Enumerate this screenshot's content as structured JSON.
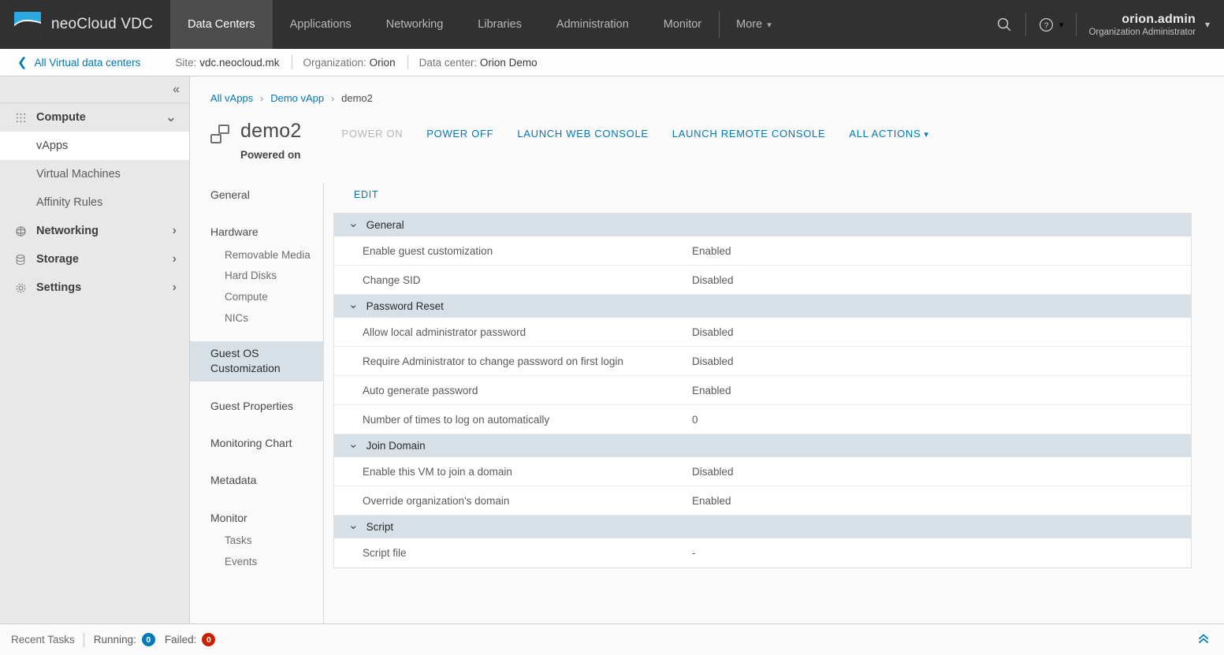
{
  "header": {
    "brand": "neoCloud VDC",
    "logo_color": "#2aa8e0",
    "nav": [
      {
        "label": "Data Centers",
        "active": true
      },
      {
        "label": "Applications",
        "active": false
      },
      {
        "label": "Networking",
        "active": false
      },
      {
        "label": "Libraries",
        "active": false
      },
      {
        "label": "Administration",
        "active": false
      },
      {
        "label": "Monitor",
        "active": false
      },
      {
        "label": "More",
        "active": false,
        "caret": true
      }
    ],
    "search_icon": "search-icon",
    "help_icon": "help-icon",
    "user_name": "orion.admin",
    "user_role": "Organization Administrator"
  },
  "context_bar": {
    "back_label": "All Virtual data centers",
    "site_label": "Site:",
    "site_value": "vdc.neocloud.mk",
    "org_label": "Organization:",
    "org_value": "Orion",
    "dc_label": "Data center:",
    "dc_value": "Orion Demo"
  },
  "sidebar": {
    "collapse_label": "«",
    "groups": [
      {
        "label": "Compute",
        "icon": "grid-icon",
        "expanded": true,
        "items": [
          {
            "label": "vApps",
            "active": true
          },
          {
            "label": "Virtual Machines",
            "active": false
          },
          {
            "label": "Affinity Rules",
            "active": false
          }
        ]
      },
      {
        "label": "Networking",
        "icon": "network-icon",
        "expanded": false,
        "items": []
      },
      {
        "label": "Storage",
        "icon": "storage-icon",
        "expanded": false,
        "items": []
      },
      {
        "label": "Settings",
        "icon": "gear-icon",
        "expanded": false,
        "items": []
      }
    ]
  },
  "breadcrumb": [
    {
      "label": "All vApps",
      "link": true
    },
    {
      "label": "Demo vApp",
      "link": true
    },
    {
      "label": "demo2",
      "link": false
    }
  ],
  "vm": {
    "name": "demo2",
    "state": "Powered on",
    "icon": "virtual-machine-icon",
    "actions": [
      {
        "label": "POWER ON",
        "disabled": true
      },
      {
        "label": "POWER OFF",
        "disabled": false
      },
      {
        "label": "LAUNCH WEB CONSOLE",
        "disabled": false
      },
      {
        "label": "LAUNCH REMOTE CONSOLE",
        "disabled": false
      },
      {
        "label": "ALL ACTIONS",
        "disabled": false,
        "caret": true
      }
    ]
  },
  "inner_nav": [
    {
      "label": "General",
      "type": "top",
      "selected": false
    },
    {
      "label": "Hardware",
      "type": "top",
      "selected": false,
      "gap": true
    },
    {
      "label": "Removable Media",
      "type": "sub",
      "selected": false
    },
    {
      "label": "Hard Disks",
      "type": "sub",
      "selected": false
    },
    {
      "label": "Compute",
      "type": "sub",
      "selected": false
    },
    {
      "label": "NICs",
      "type": "sub",
      "selected": false
    },
    {
      "label": "Guest OS Customization",
      "type": "top",
      "selected": true,
      "gap": true
    },
    {
      "label": "Guest Properties",
      "type": "top",
      "selected": false,
      "gap": true
    },
    {
      "label": "Monitoring Chart",
      "type": "top",
      "selected": false,
      "gap": true
    },
    {
      "label": "Metadata",
      "type": "top",
      "selected": false,
      "gap": true
    },
    {
      "label": "Monitor",
      "type": "top",
      "selected": false,
      "gap": true
    },
    {
      "label": "Tasks",
      "type": "sub",
      "selected": false
    },
    {
      "label": "Events",
      "type": "sub",
      "selected": false
    }
  ],
  "detail": {
    "edit_label": "EDIT",
    "sections": [
      {
        "title": "General",
        "rows": [
          {
            "key": "Enable guest customization",
            "value": "Enabled"
          },
          {
            "key": "Change SID",
            "value": "Disabled"
          }
        ]
      },
      {
        "title": "Password Reset",
        "rows": [
          {
            "key": "Allow local administrator password",
            "value": "Disabled"
          },
          {
            "key": "Require Administrator to change password on first login",
            "value": "Disabled"
          },
          {
            "key": "Auto generate password",
            "value": "Enabled"
          },
          {
            "key": "Number of times to log on automatically",
            "value": "0"
          }
        ]
      },
      {
        "title": "Join Domain",
        "rows": [
          {
            "key": "Enable this VM to join a domain",
            "value": "Disabled"
          },
          {
            "key": "Override organization's domain",
            "value": "Enabled"
          }
        ]
      },
      {
        "title": "Script",
        "rows": [
          {
            "key": "Script file",
            "value": "-"
          }
        ]
      }
    ]
  },
  "footer": {
    "label": "Recent Tasks",
    "running_label": "Running:",
    "running_count": "0",
    "failed_label": "Failed:",
    "failed_count": "0",
    "running_color": "#0079b8",
    "failed_color": "#c92100",
    "expand_icon": "chevron-double-up-icon"
  }
}
